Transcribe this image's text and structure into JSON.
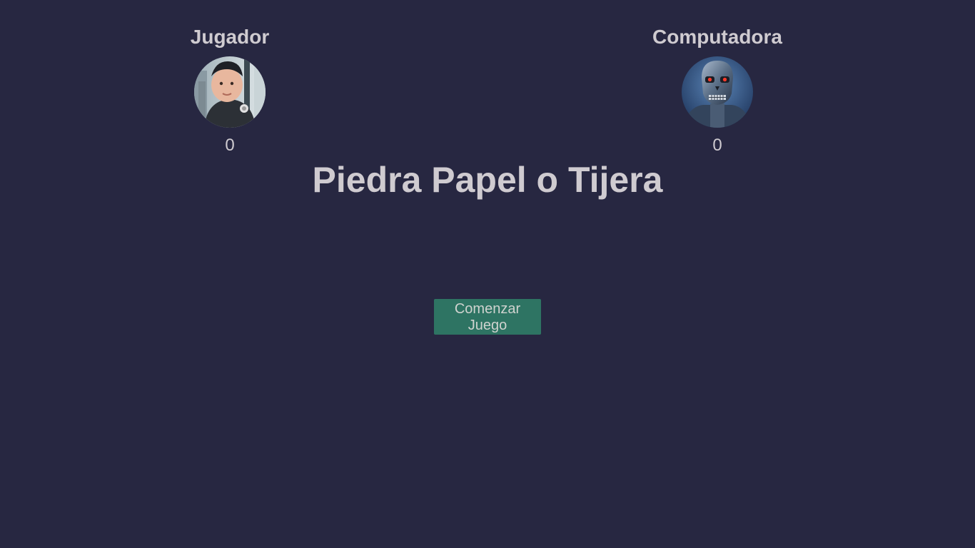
{
  "player": {
    "name": "Jugador",
    "score": "0",
    "avatar_icon": "boy-avatar"
  },
  "computer": {
    "name": "Computadora",
    "score": "0",
    "avatar_icon": "robot-skull-avatar"
  },
  "game": {
    "title": "Piedra Papel o Tijera"
  },
  "controls": {
    "start_label": "Comenzar Juego"
  },
  "colors": {
    "background": "#272741",
    "text": "#cfcbd0",
    "button": "#2e7463"
  }
}
